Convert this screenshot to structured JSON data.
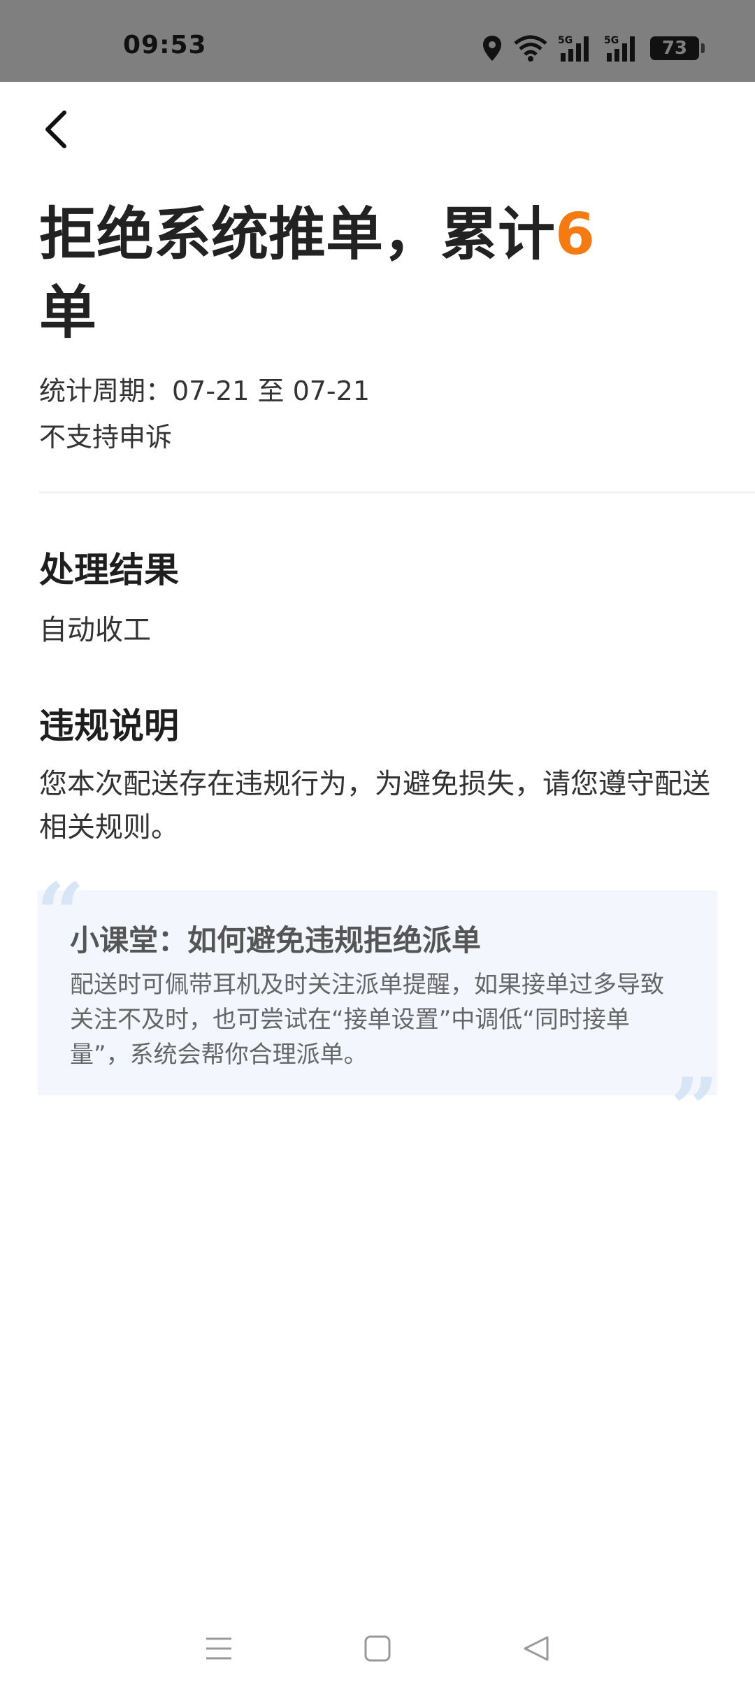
{
  "status_bar": {
    "time": "09:53",
    "battery": "73",
    "icons": [
      "location-icon",
      "wifi-icon",
      "signal-5g-icon",
      "signal-5g-icon",
      "battery-icon"
    ]
  },
  "header": {
    "back_icon": "chevron-left-icon"
  },
  "title": {
    "prefix": "拒绝系统推单，累计",
    "count": "6",
    "unit": "单",
    "count_color": "#f47b12"
  },
  "meta": {
    "period": "统计周期：07-21 至 07-21",
    "appeal": "不支持申诉"
  },
  "result": {
    "title": "处理结果",
    "text": "自动收工"
  },
  "violation": {
    "title": "违规说明",
    "text": "您本次配送存在违规行为，为避免损失，请您遵守配送相关规则。"
  },
  "tip": {
    "title": "小课堂：如何避免违规拒绝派单",
    "text": "配送时可佩带耳机及时关注派单提醒，如果接单过多导致关注不及时，也可尝试在“接单设置”中调低“同时接单量”，系统会帮你合理派单。",
    "open_quote": "“",
    "close_quote": "”"
  },
  "nav": {
    "items": [
      "menu-icon",
      "home-icon",
      "back-triangle-icon"
    ]
  }
}
